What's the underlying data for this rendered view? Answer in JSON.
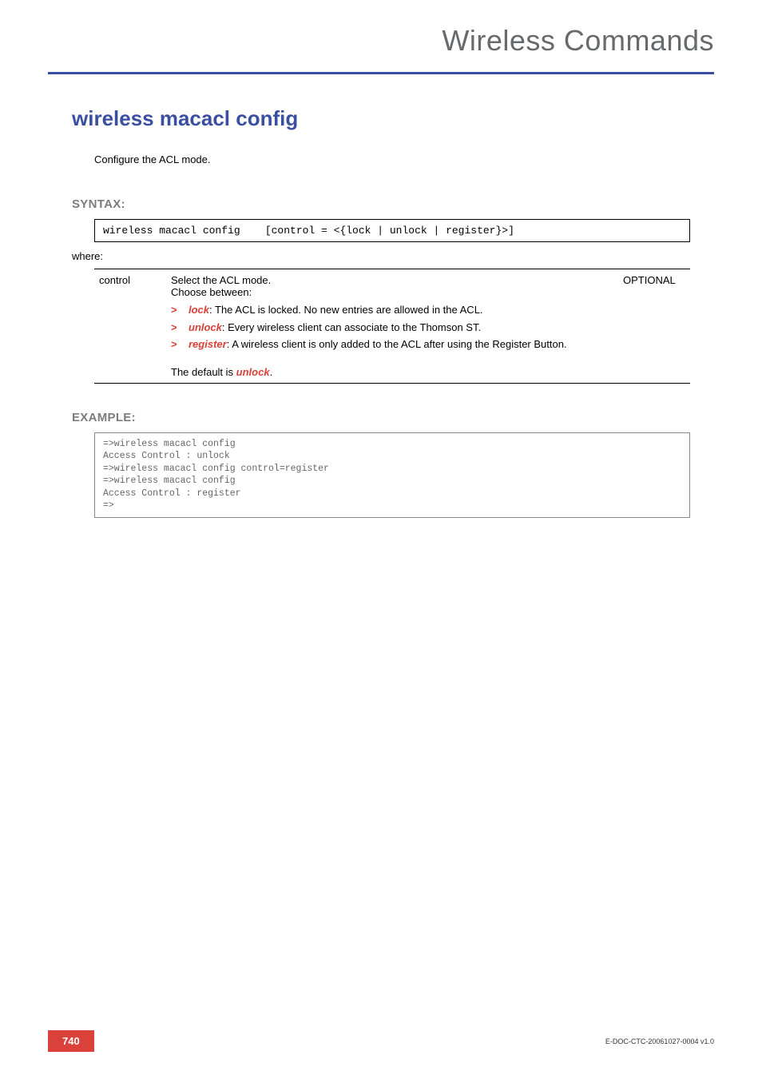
{
  "header": {
    "title": "Wireless Commands"
  },
  "command": {
    "title": "wireless macacl config",
    "intro": "Configure the ACL mode."
  },
  "syntax": {
    "heading": "SYNTAX:",
    "code": "wireless macacl config    [control = <{lock | unlock | register}>]",
    "where": "where:"
  },
  "param": {
    "name": "control",
    "desc_lead": "Select the ACL mode.\nChoose between:",
    "options": [
      {
        "kw": "lock",
        "text": ": The ACL is locked. No new entries are allowed in the ACL."
      },
      {
        "kw": "unlock",
        "text": ": Every wireless client can associate to the Thomson ST."
      },
      {
        "kw": "register",
        "text": ": A wireless client is only added to the ACL after using the Register Button."
      }
    ],
    "default_prefix": "The default is ",
    "default_kw": "unlock",
    "default_suffix": ".",
    "optional": "OPTIONAL"
  },
  "example": {
    "heading": "EXAMPLE:",
    "lines": "=>wireless macacl config\nAccess Control : unlock\n=>wireless macacl config control=register\n=>wireless macacl config\nAccess Control : register\n=>"
  },
  "footer": {
    "page": "740",
    "docid": "E-DOC-CTC-20061027-0004 v1.0"
  }
}
